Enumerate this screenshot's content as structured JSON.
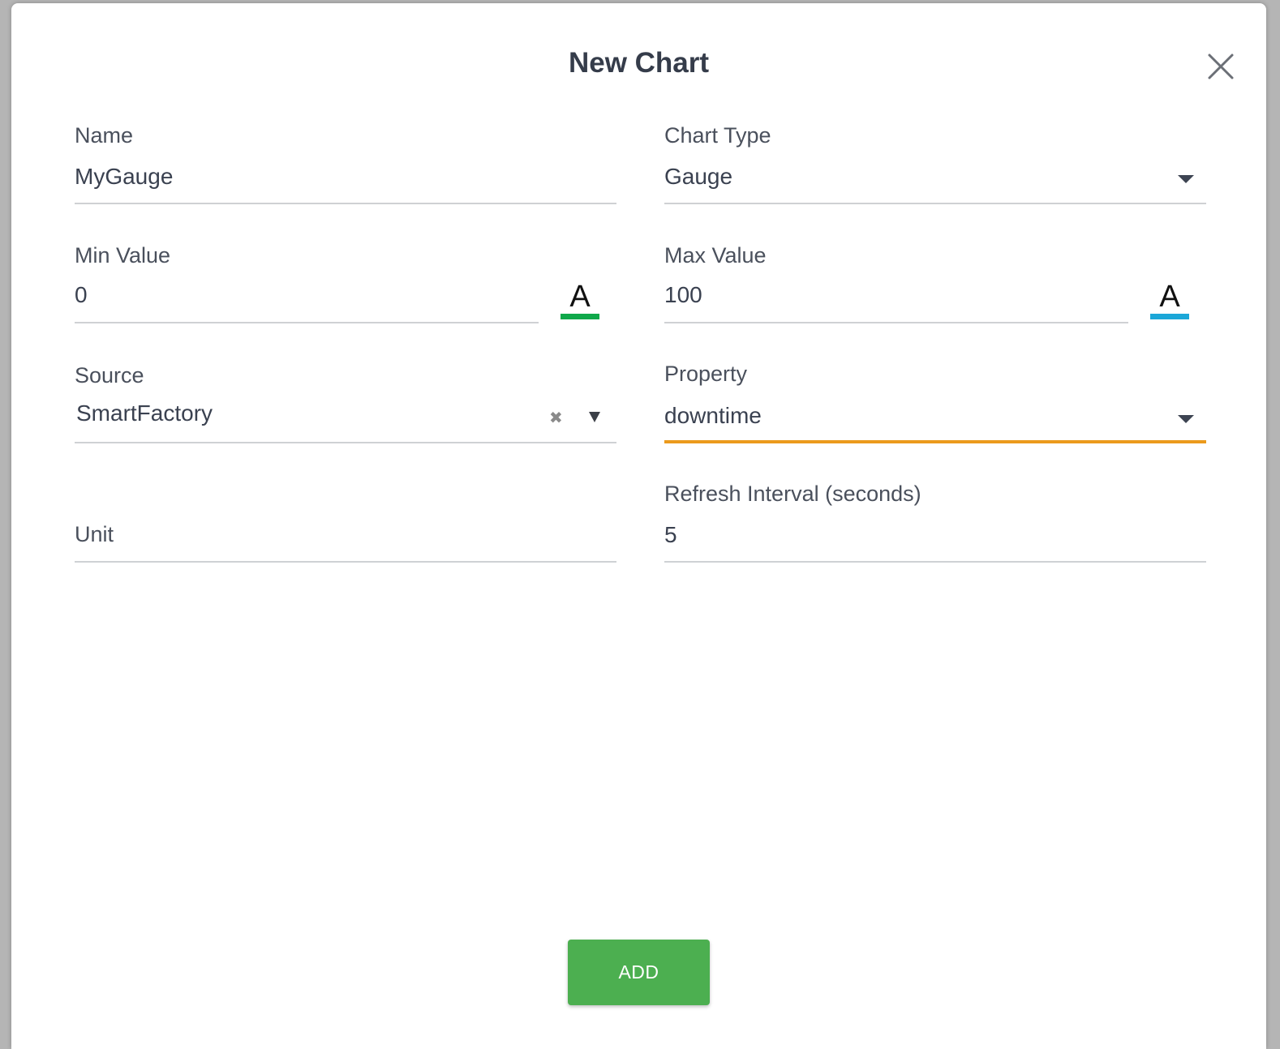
{
  "dialog": {
    "title": "New Chart",
    "close_icon": "close-icon"
  },
  "fields": {
    "name": {
      "label": "Name",
      "value": "MyGauge"
    },
    "chart_type": {
      "label": "Chart Type",
      "value": "Gauge",
      "icon": "chevron-down-icon"
    },
    "min_value": {
      "label": "Min Value",
      "value": "0",
      "color_glyph": "A",
      "color": "#0fa84a"
    },
    "max_value": {
      "label": "Max Value",
      "value": "100",
      "color_glyph": "A",
      "color": "#1ba7d8"
    },
    "source": {
      "label": "Source",
      "value": "SmartFactory",
      "clear_glyph": "✖",
      "icon": "chevron-down-icon"
    },
    "property": {
      "label": "Property",
      "value": "downtime",
      "icon": "chevron-down-icon",
      "focus_color": "#eb9a1c"
    },
    "unit": {
      "placeholder": "Unit",
      "value": ""
    },
    "refresh_interval": {
      "label": "Refresh Interval (seconds)",
      "value": "5"
    }
  },
  "actions": {
    "add_label": "ADD",
    "add_color": "#4caf50"
  }
}
